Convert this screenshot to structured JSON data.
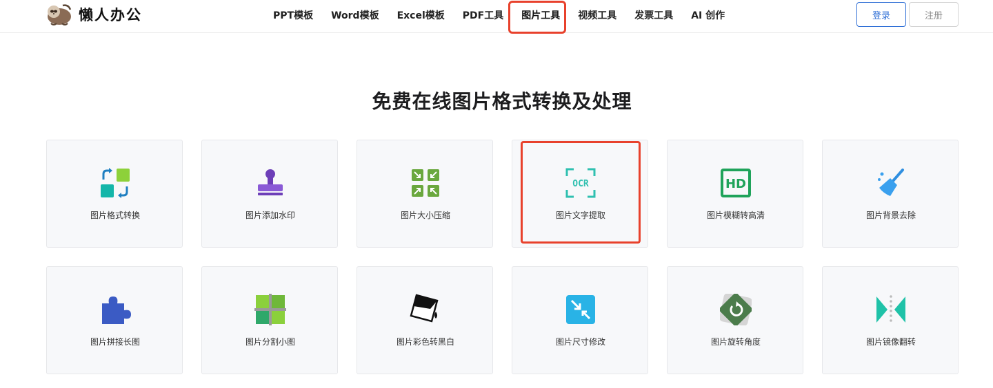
{
  "brand": {
    "name": "懒人办公",
    "logo_icon": "sloth-logo-icon"
  },
  "nav": {
    "items": [
      {
        "label": "PPT模板"
      },
      {
        "label": "Word模板"
      },
      {
        "label": "Excel模板"
      },
      {
        "label": "PDF工具"
      },
      {
        "label": "图片工具",
        "active": true
      },
      {
        "label": "视频工具"
      },
      {
        "label": "发票工具"
      },
      {
        "label": "AI 创作"
      }
    ]
  },
  "auth": {
    "login_label": "登录",
    "register_label": "注册"
  },
  "page": {
    "title": "免费在线图片格式转换及处理"
  },
  "tools": [
    {
      "label": "图片格式转换",
      "icon": "format-convert-icon"
    },
    {
      "label": "图片添加水印",
      "icon": "watermark-stamp-icon"
    },
    {
      "label": "图片大小压缩",
      "icon": "compress-icon"
    },
    {
      "label": "图片文字提取",
      "icon": "ocr-icon",
      "icon_text": "OCR"
    },
    {
      "label": "图片模糊转高清",
      "icon": "hd-icon",
      "icon_text": "HD"
    },
    {
      "label": "图片背景去除",
      "icon": "broom-icon"
    },
    {
      "label": "图片拼接长图",
      "icon": "puzzle-icon"
    },
    {
      "label": "图片分割小图",
      "icon": "grid-split-icon"
    },
    {
      "label": "图片彩色转黑白",
      "icon": "paint-bucket-icon"
    },
    {
      "label": "图片尺寸修改",
      "icon": "resize-icon"
    },
    {
      "label": "图片旋转角度",
      "icon": "rotate-icon"
    },
    {
      "label": "图片镜像翻转",
      "icon": "mirror-flip-icon"
    }
  ],
  "colors": {
    "highlight": "#e8412c",
    "primary": "#2f6fd6",
    "card_bg": "#f7f8fa"
  }
}
